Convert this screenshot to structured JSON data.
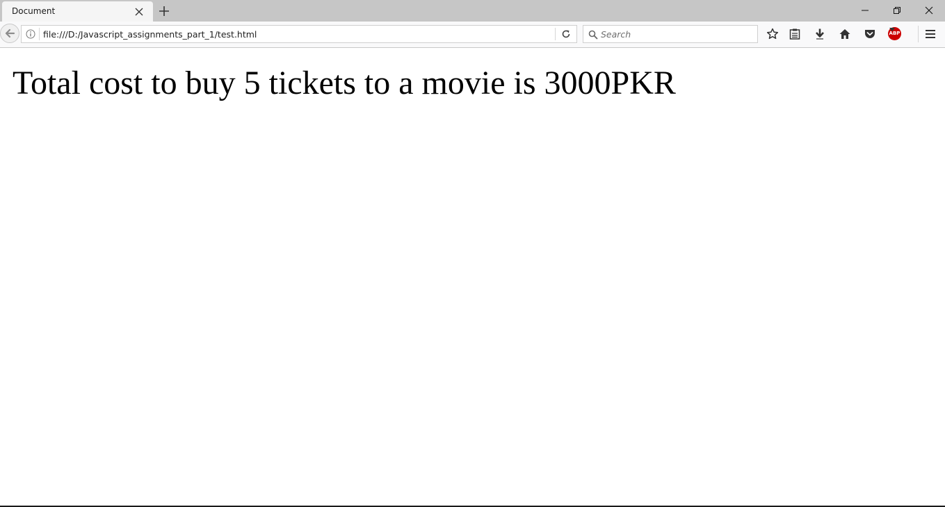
{
  "browser": {
    "tab": {
      "title": "Document"
    },
    "address_bar": {
      "url": "file:///D:/Javascript_assignments_part_1/test.html"
    },
    "search_bar": {
      "placeholder": "Search"
    },
    "icons": {
      "tab_close": "close-icon",
      "new_tab": "plus-icon",
      "minimize": "minimize-icon",
      "restore": "restore-icon",
      "close_window": "close-icon",
      "back": "arrow-left-icon",
      "site_info": "info-icon",
      "reload": "reload-icon",
      "search": "search-icon",
      "bookmark": "star-icon",
      "reading_list": "clipboard-icon",
      "downloads": "download-icon",
      "home": "home-icon",
      "pocket": "pocket-icon",
      "adblock": "abp-icon",
      "menu": "hamburger-icon"
    },
    "adblock_label": "ABP"
  },
  "page": {
    "headline": "Total cost to buy 5 tickets to a movie is 3000PKR"
  },
  "colors": {
    "tabbar": "#c6c6c6",
    "toolbar": "#f9f9fa",
    "adblock": "#cc0000"
  }
}
